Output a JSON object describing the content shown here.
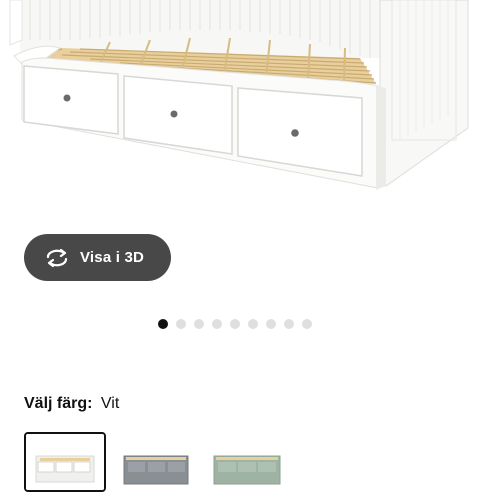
{
  "product_image": {
    "alt_icon": "daybed-image"
  },
  "view_3d": {
    "label": "Visa i 3D",
    "icon": "rotate-3d-icon"
  },
  "carousel": {
    "total": 9,
    "active": 0
  },
  "color_picker": {
    "label": "Välj färg:",
    "selected_value": "Vit",
    "options": [
      {
        "name": "Vit",
        "color": "#f4f4f2",
        "selected": true
      },
      {
        "name": "Grå",
        "color": "#8a8f94",
        "selected": false
      },
      {
        "name": "Grön",
        "color": "#9fb3a4",
        "selected": false
      }
    ]
  }
}
